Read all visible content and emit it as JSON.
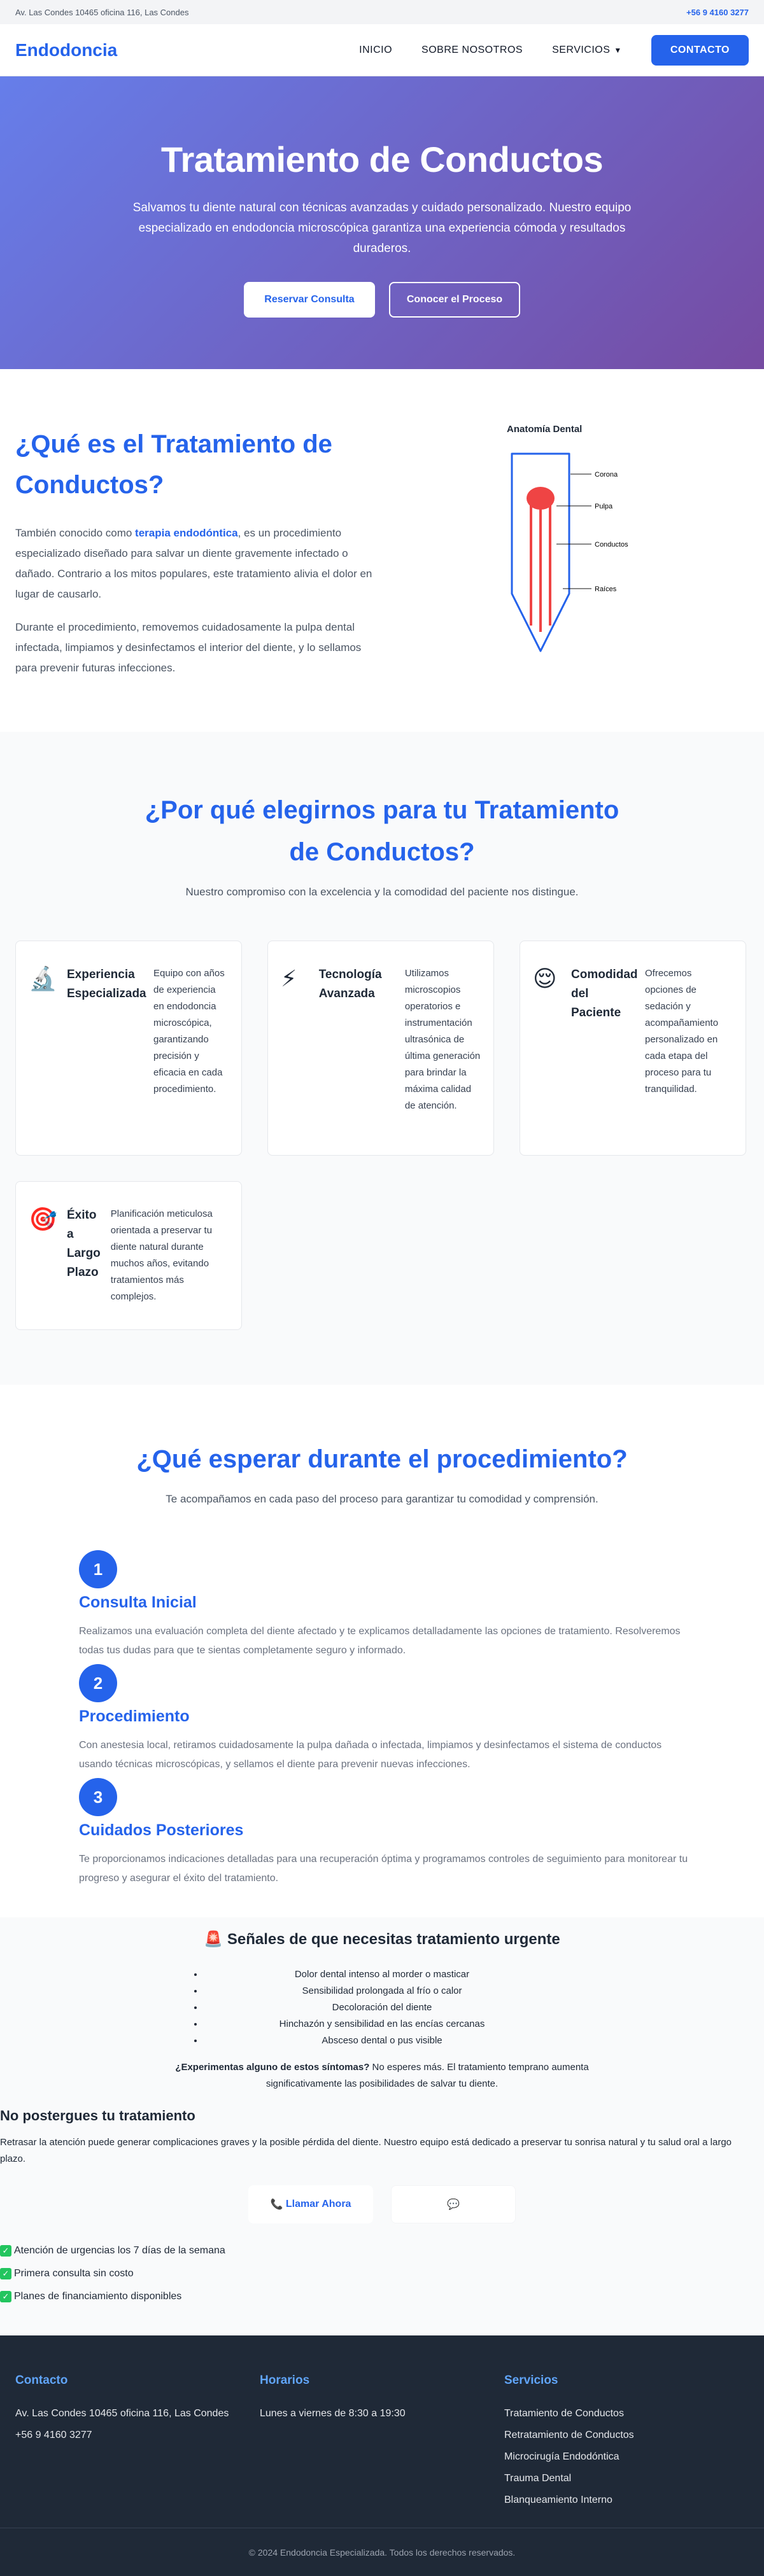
{
  "topbar": {
    "address": "Av. Las Condes 10465 oficina 116, Las Condes",
    "phone": "+56 9 4160 3277"
  },
  "header": {
    "logo": "Endodoncia",
    "nav": {
      "inicio": "INICIO",
      "sobre": "SOBRE NOSOTROS",
      "servicios": "SERVICIOS",
      "caret": "▼",
      "contacto": "CONTACTO"
    }
  },
  "hero": {
    "title": "Tratamiento de Conductos",
    "text": "Salvamos tu diente natural con técnicas avanzadas y cuidado personalizado. Nuestro equipo especializado en endodoncia microscópica garantiza una experiencia cómoda y resultados duraderos.",
    "btn_primary": "Reservar Consulta",
    "btn_secondary": "Conocer el Proceso"
  },
  "what": {
    "title": "¿Qué es el Tratamiento de Conductos?",
    "p1_pre": "También conocido como ",
    "p1_bold": "terapia endodóntica",
    "p1_post": ", es un procedimiento especializado diseñado para salvar un diente gravemente infectado o dañado. Contrario a los mitos populares, este tratamiento alivia el dolor en lugar de causarlo.",
    "p2": "Durante el procedimiento, removemos cuidadosamente la pulpa dental infectada, limpiamos y desinfectamos el interior del diente, y lo sellamos para prevenir futuras infecciones.",
    "diagram": {
      "title": "Anatomía Dental",
      "labels": {
        "corona": "Corona",
        "pulpa": "Pulpa",
        "conductos": "Conductos",
        "raices": "Raíces"
      }
    }
  },
  "why": {
    "title": "¿Por qué elegirnos para tu Tratamiento de Conductos?",
    "subtitle": "Nuestro compromiso con la excelencia y la comodidad del paciente nos distingue.",
    "cards": [
      {
        "icon": "🔬",
        "title": "Experiencia Especializada",
        "text": "Equipo con años de experiencia en endodoncia microscópica, garantizando precisión y eficacia en cada procedimiento."
      },
      {
        "icon": "⚡",
        "title": "Tecnología Avanzada",
        "text": "Utilizamos microscopios operatorios e instrumentación ultrasónica de última generación para brindar la máxima calidad de atención."
      },
      {
        "icon": "😌",
        "title": "Comodidad del Paciente",
        "text": "Ofrecemos opciones de sedación y acompañamiento personalizado en cada etapa del proceso para tu tranquilidad."
      },
      {
        "icon": "🎯",
        "title": "Éxito a Largo Plazo",
        "text": "Planificación meticulosa orientada a preservar tu diente natural durante muchos años, evitando tratamientos más complejos."
      }
    ]
  },
  "expect": {
    "title": "¿Qué esperar durante el procedimiento?",
    "subtitle": "Te acompañamos en cada paso del proceso para garantizar tu comodidad y comprensión.",
    "steps": [
      {
        "num": "1",
        "title": "Consulta Inicial",
        "text": "Realizamos una evaluación completa del diente afectado y te explicamos detalladamente las opciones de tratamiento. Resolveremos todas tus dudas para que te sientas completamente seguro y informado."
      },
      {
        "num": "2",
        "title": "Procedimiento",
        "text": "Con anestesia local, retiramos cuidadosamente la pulpa dañada o infectada, limpiamos y desinfectamos el sistema de conductos usando técnicas microscópicas, y sellamos el diente para prevenir nuevas infecciones."
      },
      {
        "num": "3",
        "title": "Cuidados Posteriores",
        "text": "Te proporcionamos indicaciones detalladas para una recuperación óptima y programamos controles de seguimiento para monitorear tu progreso y asegurar el éxito del tratamiento."
      }
    ]
  },
  "urgent": {
    "icon": "🚨",
    "title": "Señales de que necesitas tratamiento urgente",
    "signs": [
      "Dolor dental intenso al morder o masticar",
      "Sensibilidad prolongada al frío o calor",
      "Decoloración del diente",
      "Hinchazón y sensibilidad en las encías cercanas",
      "Absceso dental o pus visible"
    ],
    "note_bold": "¿Experimentas alguno de estos síntomas?",
    "note": " No esperes más. El tratamiento temprano aumenta significativamente las posibilidades de salvar tu diente.",
    "cta_title": "No postergues tu tratamiento",
    "cta_text": "Retrasar la atención puede generar complicaciones graves y la posible pérdida del diente. Nuestro equipo está dedicado a preservar tu sonrisa natural y tu salud oral a largo plazo.",
    "call_icon": "📞",
    "call_label": "Llamar Ahora",
    "chat_icon": "💬",
    "checks": [
      "Atención de urgencias los 7 días de la semana",
      "Primera consulta sin costo",
      "Planes de financiamiento disponibles"
    ]
  },
  "footer": {
    "contact": {
      "title": "Contacto",
      "address": "Av. Las Condes 10465 oficina 116, Las Condes",
      "phone": "+56 9 4160 3277"
    },
    "hours": {
      "title": "Horarios",
      "text": "Lunes a viernes de 8:30 a 19:30"
    },
    "services": {
      "title": "Servicios",
      "items": [
        "Tratamiento de Conductos",
        "Retratamiento de Conductos",
        "Microcirugía Endodóntica",
        "Trauma Dental",
        "Blanqueamiento Interno"
      ]
    },
    "copyright": "© 2024 Endodoncia Especializada. Todos los derechos reservados."
  },
  "colors": {
    "primary": "#2563eb",
    "hero_start": "#667eea",
    "hero_end": "#764ba2",
    "footer_bg": "#1f2937",
    "footer_heading": "#60a5fa"
  }
}
